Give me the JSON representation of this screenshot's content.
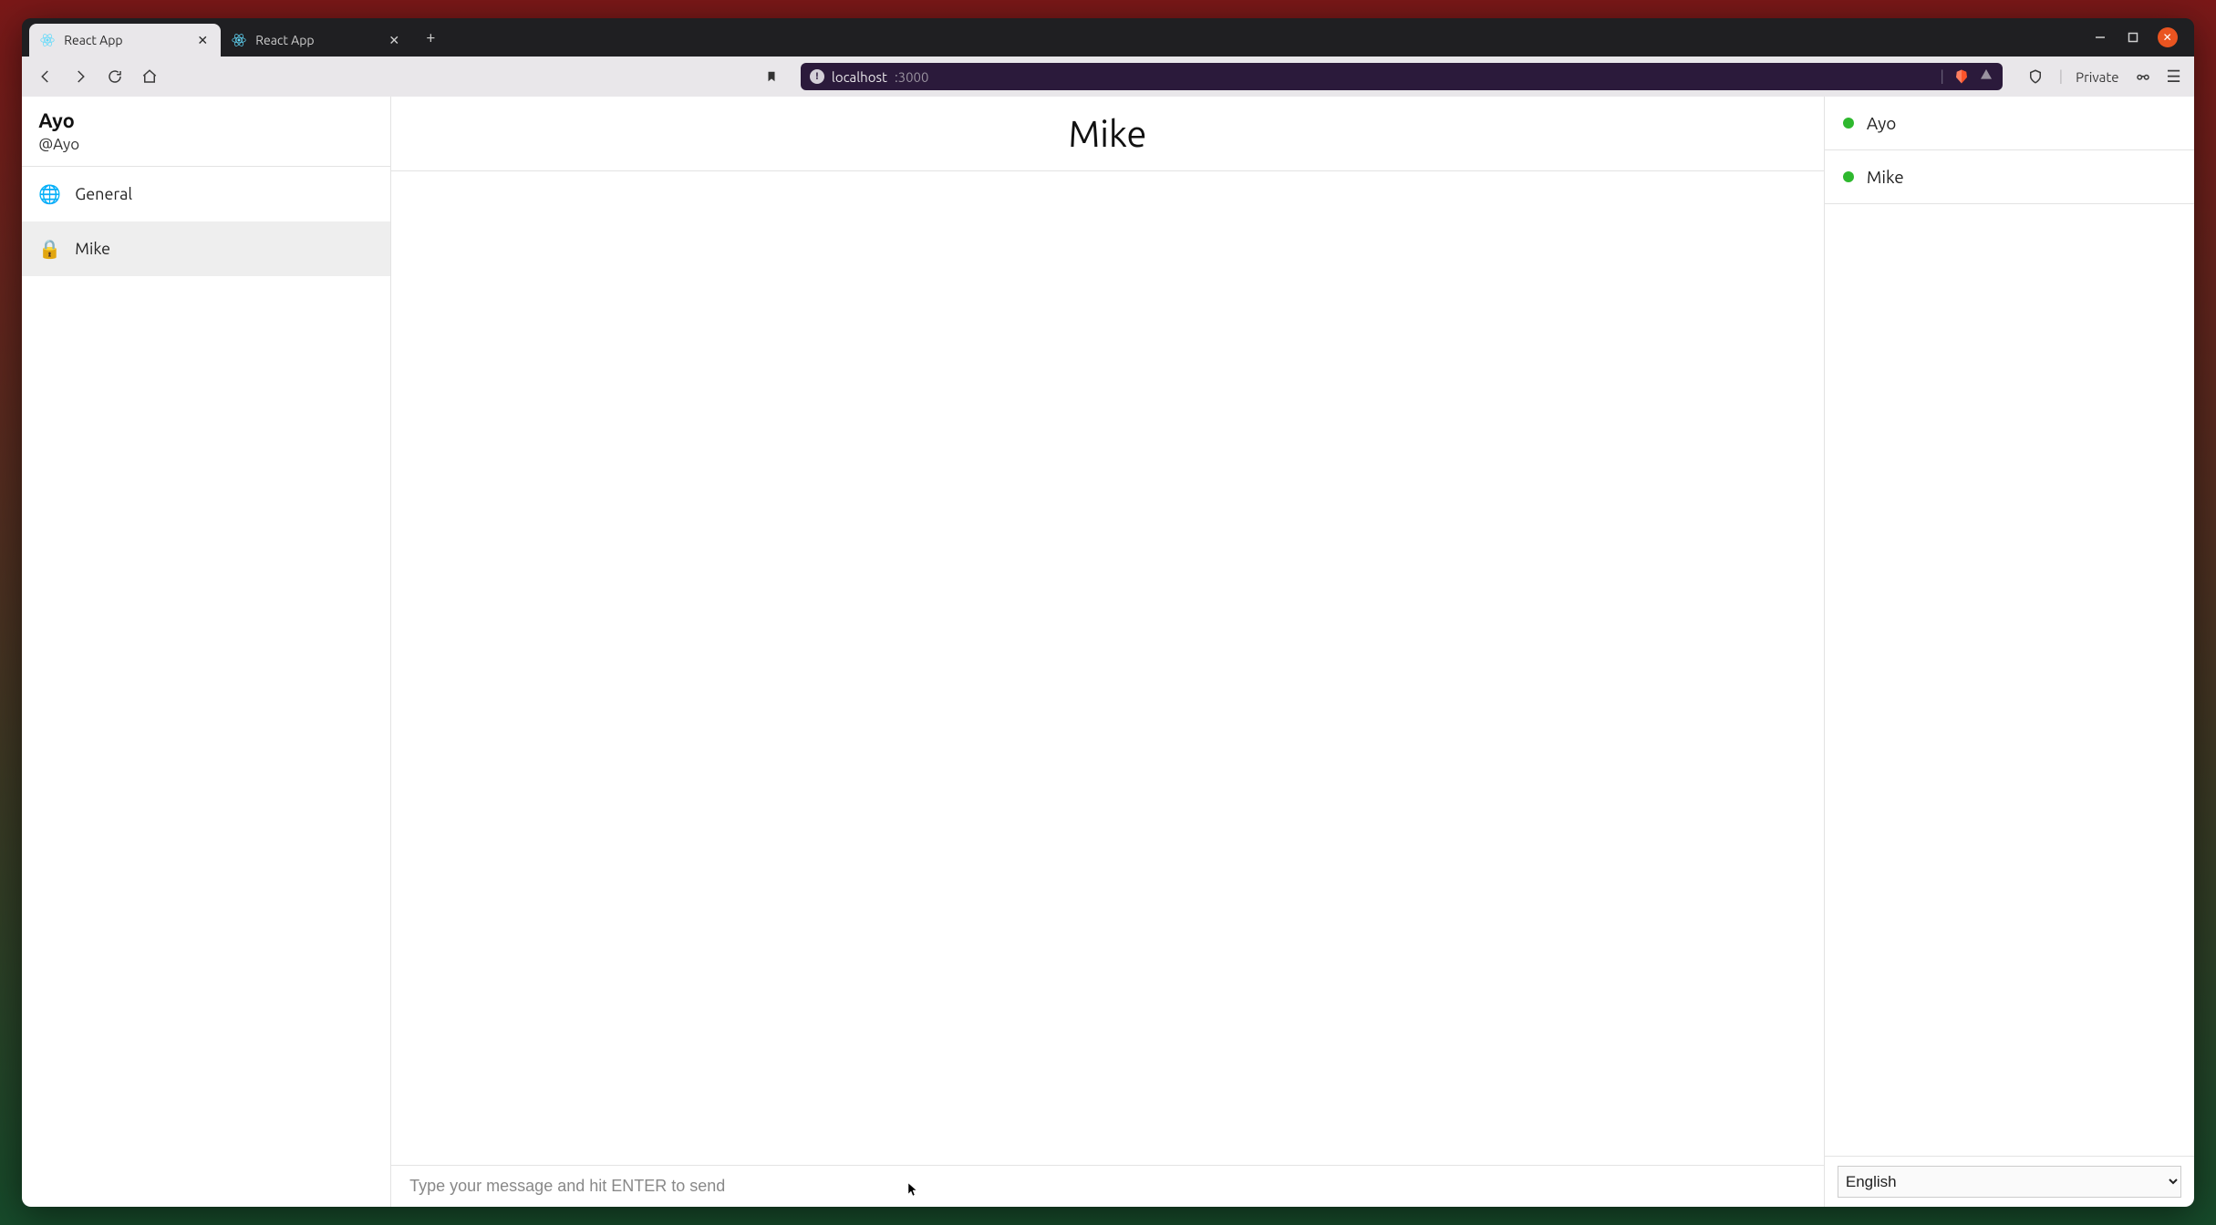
{
  "browser": {
    "tabs": [
      {
        "title": "React App",
        "active": true
      },
      {
        "title": "React App",
        "active": false
      }
    ],
    "address": {
      "host": "localhost",
      "port": ":3000"
    },
    "private_label": "Private"
  },
  "sidebar": {
    "user": {
      "name": "Ayo",
      "handle": "@Ayo"
    },
    "channels": [
      {
        "icon": "🌐",
        "label": "General",
        "active": false
      },
      {
        "icon": "🔒",
        "label": "Mike",
        "active": true
      }
    ]
  },
  "chat": {
    "title": "Mike",
    "input_placeholder": "Type your message and hit ENTER to send"
  },
  "presence": [
    {
      "name": "Ayo",
      "online": true
    },
    {
      "name": "Mike",
      "online": true
    }
  ],
  "language": {
    "selected": "English"
  }
}
